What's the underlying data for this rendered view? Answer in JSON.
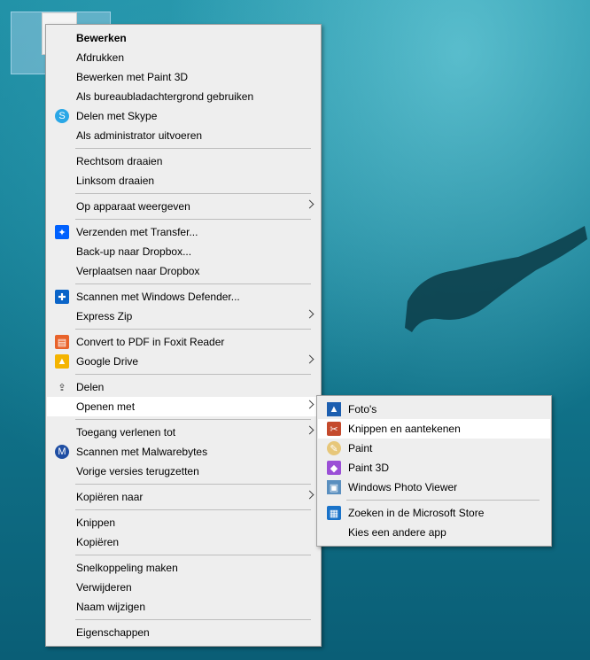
{
  "context_menu": {
    "groups": [
      [
        {
          "label": "Bewerken",
          "bold": true
        },
        {
          "label": "Afdrukken"
        },
        {
          "label": "Bewerken met Paint 3D"
        },
        {
          "label": "Als bureaubladachtergrond gebruiken"
        },
        {
          "label": "Delen met Skype",
          "icon": "skype-icon"
        },
        {
          "label": "Als administrator uitvoeren"
        }
      ],
      [
        {
          "label": "Rechtsom draaien"
        },
        {
          "label": "Linksom draaien"
        }
      ],
      [
        {
          "label": "Op apparaat weergeven",
          "submenu": true
        }
      ],
      [
        {
          "label": "Verzenden met Transfer...",
          "icon": "dropbox-icon"
        },
        {
          "label": "Back-up naar Dropbox..."
        },
        {
          "label": "Verplaatsen naar Dropbox"
        }
      ],
      [
        {
          "label": "Scannen met Windows Defender...",
          "icon": "windows-defender-icon"
        },
        {
          "label": "Express Zip",
          "submenu": true
        }
      ],
      [
        {
          "label": "Convert to PDF in Foxit Reader",
          "icon": "foxit-pdf-icon"
        },
        {
          "label": "Google Drive",
          "icon": "google-drive-icon",
          "submenu": true
        }
      ],
      [
        {
          "label": "Delen",
          "icon": "share-icon"
        },
        {
          "label": "Openen met",
          "submenu": true,
          "hover": true
        }
      ],
      [
        {
          "label": "Toegang verlenen tot",
          "submenu": true
        },
        {
          "label": "Scannen met Malwarebytes",
          "icon": "malwarebytes-icon"
        },
        {
          "label": "Vorige versies terugzetten"
        }
      ],
      [
        {
          "label": "Kopiëren naar",
          "submenu": true
        }
      ],
      [
        {
          "label": "Knippen"
        },
        {
          "label": "Kopiëren"
        }
      ],
      [
        {
          "label": "Snelkoppeling maken"
        },
        {
          "label": "Verwijderen"
        },
        {
          "label": "Naam wijzigen"
        }
      ],
      [
        {
          "label": "Eigenschappen"
        }
      ]
    ]
  },
  "open_with_submenu": {
    "groups": [
      [
        {
          "label": "Foto's",
          "icon": "photos-icon"
        },
        {
          "label": "Knippen en aantekenen",
          "icon": "snip-sketch-icon",
          "hover": true
        },
        {
          "label": "Paint",
          "icon": "paint-icon"
        },
        {
          "label": "Paint 3D",
          "icon": "paint-3d-icon"
        },
        {
          "label": "Windows Photo Viewer",
          "icon": "photo-viewer-icon"
        }
      ],
      [
        {
          "label": "Zoeken in de Microsoft Store",
          "icon": "microsoft-store-icon"
        },
        {
          "label": "Kies een andere app"
        }
      ]
    ]
  }
}
